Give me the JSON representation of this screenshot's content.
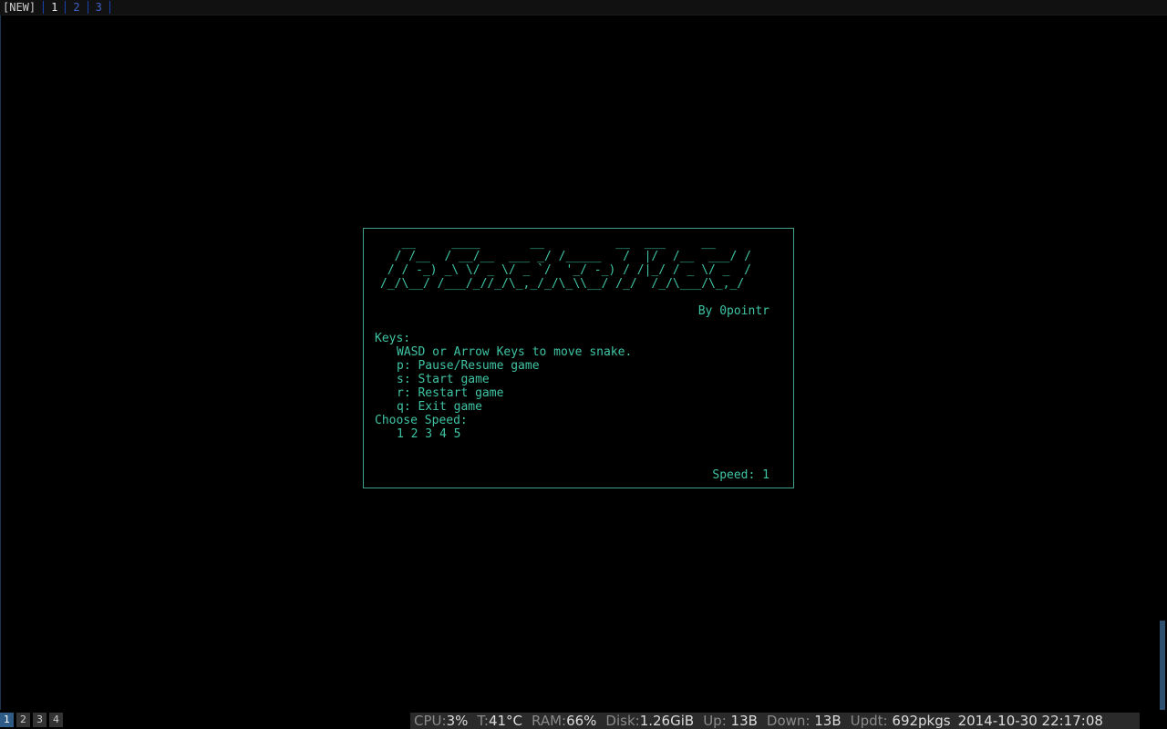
{
  "tabbar": {
    "new_label": "[NEW]",
    "tabs": [
      "1",
      "2",
      "3"
    ]
  },
  "game": {
    "logo_ascii": "   __     ____       __          __  ___     __\n  / /__  / __/__  ___ _/ /_____   /  |/  /__  ___/ /\n / / -_) _\\ \\/ _ \\/ _ `/  '_/ -_) / /|_/ / _ \\/ _  / \n/_/\\__/ /___/_//_/\\_,_/_/\\_\\\\__/ /_/  /_/\\___/\\_,_/ ",
    "author": "By 0pointr",
    "keys_heading": "Keys:",
    "key_lines": [
      "WASD or Arrow Keys to move snake.",
      "p: Pause/Resume game",
      "s: Start game",
      "r: Restart game",
      "q: Exit game"
    ],
    "speed_heading": "Choose Speed:",
    "speed_options": "1 2 3 4 5",
    "speed_status": "Speed: 1"
  },
  "statusbar": {
    "workspaces": [
      "1",
      "2",
      "3",
      "4"
    ],
    "active_workspace": "1",
    "cpu_label": "CPU:",
    "cpu_value": "3%",
    "temp_label": "T:",
    "temp_value": "41°C",
    "ram_label": "RAM:",
    "ram_value": "66%",
    "disk_label": "Disk:",
    "disk_value": "1.26GiB",
    "up_label": "Up:",
    "up_value": "13B",
    "down_label": "Down:",
    "down_value": "13B",
    "updt_label": "Updt:",
    "updt_value": "692pkgs",
    "datetime": "2014-10-30 22:17:08"
  },
  "colors": {
    "terminal_bg": "#000000",
    "game_text": "#3fc4a4",
    "tab_text": "#3f63c7",
    "active_workspace": "#2f5c86"
  }
}
